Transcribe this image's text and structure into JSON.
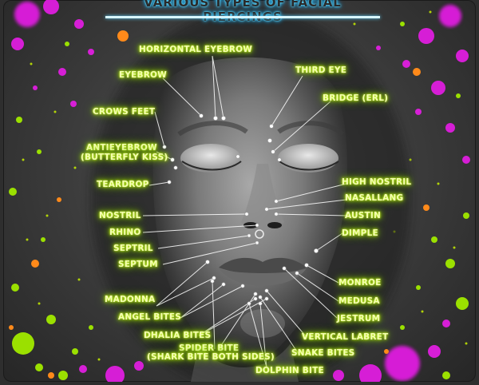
{
  "title": "VARIOUS TYPES OF FACIAL PIERCINGS",
  "labels": {
    "horizontal_eyebrow": "HORIZONTAL EYEBROW",
    "eyebrow": "EYEBROW",
    "third_eye": "THIRD EYE",
    "bridge": "BRIDGE (ERL)",
    "crows_feet": "CROWS FEET",
    "antieyebrow_1": "ANTIEYEBROW",
    "antieyebrow_2": "(BUTTERFLY KISS)",
    "teardrop": "TEARDROP",
    "high_nostril": "HIGH NOSTRIL",
    "nasallang": "NASALLANG",
    "nostril": "NOSTRIL",
    "austin": "AUSTIN",
    "rhino": "RHINO",
    "dimple": "DIMPLE",
    "septril": "SEPTRIL",
    "septum": "SEPTUM",
    "monroe": "MONROE",
    "madonna": "MADONNA",
    "medusa": "MEDUSA",
    "angel_bites": "ANGEL BITES",
    "jestrum": "JESTRUM",
    "dahlia_bites": "DHALIA BITES",
    "vertical_labret": "VERTICAL LABRET",
    "spider_bite_1": "SPIDER BITE",
    "spider_bite_2": "(SHARK BITE BOTH SIDES)",
    "snake_bites": "SNAKE BITES",
    "dolphin_bite": "DOLPHIN BITE"
  },
  "colors": {
    "label_glow": "#b6f000",
    "label_text": "#f4ffb0",
    "title_glow": "#30c8ff",
    "splatter_magenta": "#e01ee0",
    "splatter_green": "#9be000",
    "splatter_orange": "#ff8a1a",
    "leader_line": "#ffffff"
  }
}
